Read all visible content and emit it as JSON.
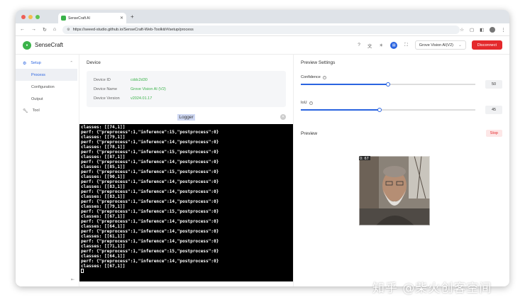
{
  "browser": {
    "tab_title": "SenseCraft AI",
    "url": "https://seeed-studio.github.io/SenseCraft-Web-Toolkit/#/setup/process"
  },
  "app": {
    "brand": "SenseCraft",
    "device_select": "Grove Vision AI(V2)",
    "disconnect_label": "Disconnect"
  },
  "sidebar": {
    "setup": "Setup",
    "process": "Process",
    "configuration": "Configuration",
    "output": "Output",
    "tool": "Tool"
  },
  "device": {
    "title": "Device",
    "rows": [
      {
        "key": "Device ID",
        "value": "cddc2d30"
      },
      {
        "key": "Device Name",
        "value": "Grove Vision AI (V2)"
      },
      {
        "key": "Device Version",
        "value": "v2024.01.17"
      }
    ]
  },
  "logger": {
    "title": "Logger",
    "lines": [
      "classes: [[74,1]]",
      "perf: {\"preprocess\":1,\"inference\":15,\"postprocess\":0}",
      "classes: [[79,1]]",
      "perf: {\"preprocess\":1,\"inference\":14,\"postprocess\":0}",
      "classes: [[78,1]]",
      "perf: {\"preprocess\":1,\"inference\":15,\"postprocess\":0}",
      "classes: [[87,1]]",
      "perf: {\"preprocess\":1,\"inference\":14,\"postprocess\":0}",
      "classes: [[85,1]]",
      "perf: {\"preprocess\":1,\"inference\":15,\"postprocess\":0}",
      "classes: [[90,1]]",
      "perf: {\"preprocess\":1,\"inference\":14,\"postprocess\":0}",
      "classes: [[83,1]]",
      "perf: {\"preprocess\":1,\"inference\":14,\"postprocess\":0}",
      "classes: [[83,1]]",
      "perf: {\"preprocess\":1,\"inference\":14,\"postprocess\":0}",
      "classes: [[79,1]]",
      "perf: {\"preprocess\":1,\"inference\":15,\"postprocess\":0}",
      "classes: [[67,1]]",
      "perf: {\"preprocess\":1,\"inference\":14,\"postprocess\":0}",
      "classes: [[64,1]]",
      "perf: {\"preprocess\":1,\"inference\":14,\"postprocess\":0}",
      "classes: [[61,1]]",
      "perf: {\"preprocess\":1,\"inference\":14,\"postprocess\":0}",
      "classes: [[71,1]]",
      "perf: {\"preprocess\":1,\"inference\":15,\"postprocess\":0}",
      "classes: [[64,1]]",
      "perf: {\"preprocess\":1,\"inference\":14,\"postprocess\":0}",
      "classes: [[67,1]]"
    ]
  },
  "preview_settings": {
    "title": "Preview Settings",
    "confidence_label": "Confidence",
    "confidence_value": 50,
    "iou_label": "IoU",
    "iou_value": 45
  },
  "preview": {
    "title": "Preview",
    "stop_label": "Stop",
    "overlay_text": "0: 67"
  },
  "watermark": "知乎 @柴火创客空间"
}
